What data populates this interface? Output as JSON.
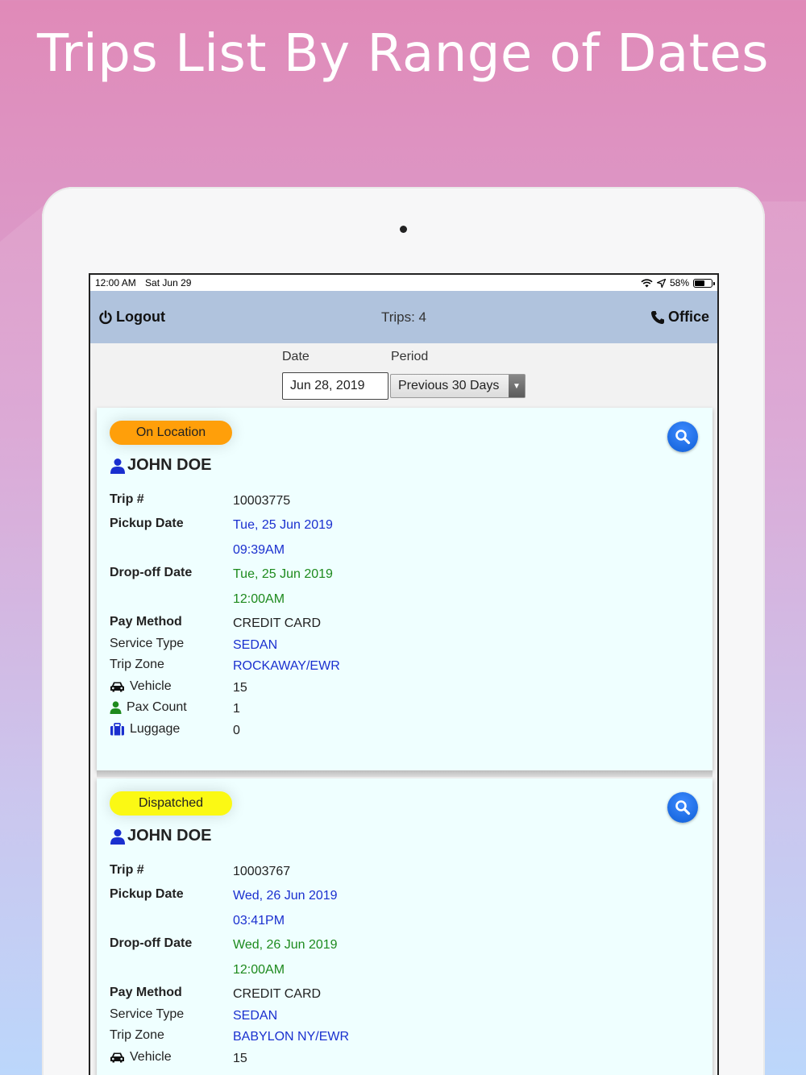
{
  "headline": "Trips List By Range of Dates",
  "status_bar": {
    "time": "12:00 AM",
    "date": "Sat Jun 29",
    "battery": "58%",
    "battery_level": 0.58
  },
  "nav": {
    "logout_label": "Logout",
    "title": "Trips: 4",
    "office_label": "Office"
  },
  "filters": {
    "date_label": "Date",
    "period_label": "Period",
    "date_value": "Jun 28, 2019",
    "period_value": "Previous 30 Days"
  },
  "labels": {
    "trip_no": "Trip #",
    "pickup_date": "Pickup Date",
    "dropoff_date": "Drop-off Date",
    "pay_method": "Pay Method",
    "service_type": "Service Type",
    "trip_zone": "Trip Zone",
    "vehicle": "Vehicle",
    "pax_count": "Pax Count",
    "luggage": "Luggage"
  },
  "trips": [
    {
      "status": "On Location",
      "status_color": "#ff9f0a",
      "customer": "JOHN DOE",
      "trip_no": "10003775",
      "pickup_date": "Tue, 25 Jun 2019",
      "pickup_time": "09:39AM",
      "dropoff_date": "Tue, 25 Jun 2019",
      "dropoff_time": "12:00AM",
      "pay_method": "CREDIT CARD",
      "service_type": "SEDAN",
      "trip_zone": "ROCKAWAY/EWR",
      "vehicle": "15",
      "pax_count": "1",
      "luggage": "0"
    },
    {
      "status": "Dispatched",
      "status_color": "#fbf914",
      "customer": "JOHN DOE",
      "trip_no": "10003767",
      "pickup_date": "Wed, 26 Jun 2019",
      "pickup_time": "03:41PM",
      "dropoff_date": "Wed, 26 Jun 2019",
      "dropoff_time": "12:00AM",
      "pay_method": "CREDIT CARD",
      "service_type": "SEDAN",
      "trip_zone": "BABYLON NY/EWR",
      "vehicle": "15"
    }
  ],
  "colors": {
    "nav_bg": "#b0c3dd",
    "card_bg": "#efffff",
    "date_blue": "#1a2fcf",
    "date_green": "#1d8a1d",
    "icon_blue": "#1a2fcf",
    "icon_green": "#1d8a1d"
  }
}
